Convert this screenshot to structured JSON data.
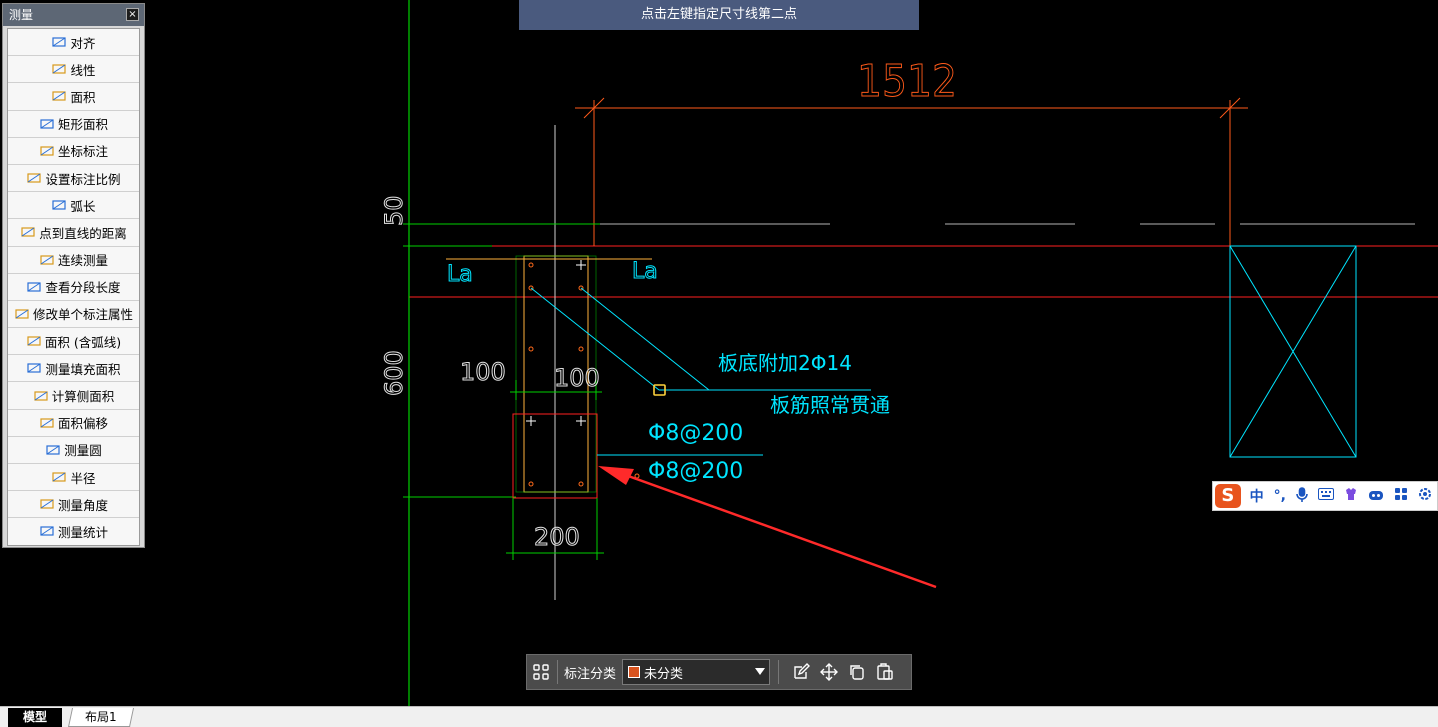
{
  "prompt": {
    "text": "点击左键指定尺寸线第二点"
  },
  "measure_panel": {
    "title": "测量",
    "close": "×",
    "tools": [
      {
        "label": "对齐",
        "icon": "aligned-dimension-icon"
      },
      {
        "label": "线性",
        "icon": "linear-dimension-icon"
      },
      {
        "label": "面积",
        "icon": "area-icon"
      },
      {
        "label": "矩形面积",
        "icon": "rectangle-area-icon"
      },
      {
        "label": "坐标标注",
        "icon": "coordinate-icon"
      },
      {
        "label": "设置标注比例",
        "icon": "scale-icon"
      },
      {
        "label": "弧长",
        "icon": "arc-length-icon"
      },
      {
        "label": "点到直线的距离",
        "icon": "point-line-distance-icon"
      },
      {
        "label": "连续测量",
        "icon": "continuous-measure-icon"
      },
      {
        "label": "查看分段长度",
        "icon": "segment-length-icon"
      },
      {
        "label": "修改单个标注属性",
        "icon": "edit-annotation-icon"
      },
      {
        "label": "面积 (含弧线)",
        "icon": "arc-area-icon"
      },
      {
        "label": "测量填充面积",
        "icon": "fill-area-icon"
      },
      {
        "label": "计算侧面积",
        "icon": "side-area-icon"
      },
      {
        "label": "面积偏移",
        "icon": "area-offset-icon"
      },
      {
        "label": "测量圆",
        "icon": "circle-measure-icon"
      },
      {
        "label": "半径",
        "icon": "radius-icon"
      },
      {
        "label": "测量角度",
        "icon": "angle-icon"
      },
      {
        "label": "测量统计",
        "icon": "statistics-icon"
      }
    ]
  },
  "drawing": {
    "dim_1512": "1512",
    "dim_50": "50",
    "dim_600": "600",
    "dim_100_left": "100",
    "dim_100_right": "100",
    "dim_200": "200",
    "la_left": "La",
    "la_right": "La",
    "note_extra_rebar": "板底附加2Φ14",
    "note_through": "板筋照常贯通",
    "note_rebar_1": "Φ8@200",
    "note_rebar_2": "Φ8@200",
    "colors": {
      "red": "#ff2020",
      "green": "#00e000",
      "cyan": "#00e5ff",
      "orange": "#ff6a1a",
      "white": "#ffffff",
      "yellow": "#ffd23c"
    }
  },
  "annotation_bar": {
    "category_label": "标注分类",
    "category_value": "未分类",
    "swatch_color": "#d9531e"
  },
  "ime": {
    "logo": "S",
    "mode": "中",
    "punct": "°,"
  },
  "tabs": {
    "model": "模型",
    "layout": "布局1"
  }
}
